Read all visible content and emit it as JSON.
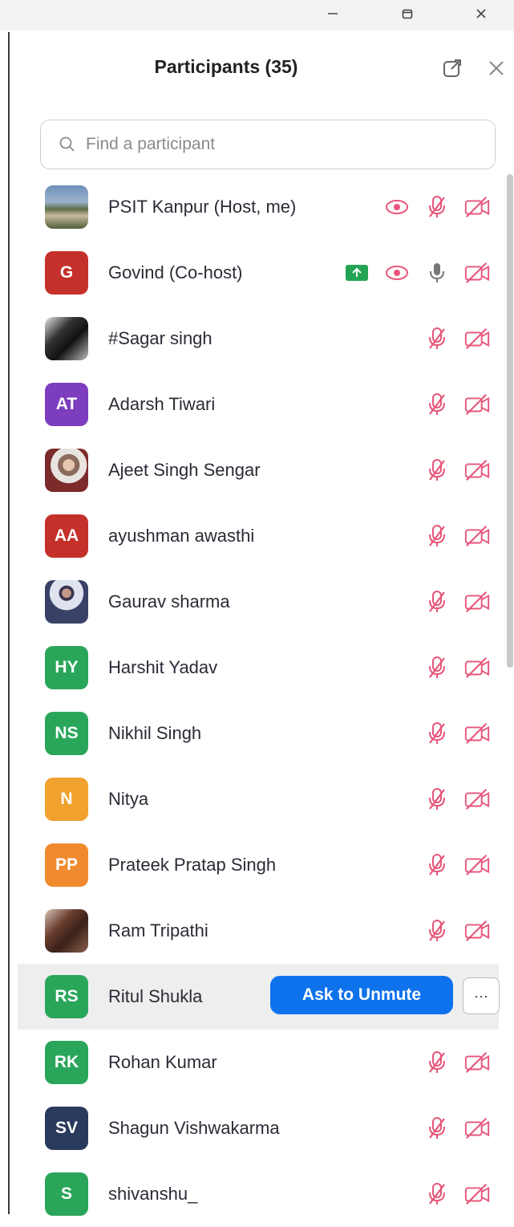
{
  "window": {
    "minimize_glyph": "–",
    "close_glyph": "✕"
  },
  "panel": {
    "title": "Participants (35)"
  },
  "search": {
    "placeholder": "Find a participant"
  },
  "colors": {
    "accent_blue": "#0e72ed",
    "muted_red": "#e8557a",
    "share_green": "#23a455"
  },
  "participants": [
    {
      "name": "PSIT Kanpur (Host, me)",
      "avatar": "photo-building",
      "icons": [
        "spotlight-icon",
        "mic-muted-icon",
        "video-off-icon"
      ]
    },
    {
      "name": "Govind (Co-host)",
      "initials": "G",
      "color": "#c4312a",
      "icons": [
        "screen-share-icon",
        "spotlight-icon",
        "mic-on-icon",
        "video-off-icon"
      ]
    },
    {
      "name": "#Sagar singh",
      "avatar": "photo-dark",
      "icons": [
        "mic-muted-icon",
        "video-off-icon"
      ]
    },
    {
      "name": "Adarsh Tiwari",
      "initials": "AT",
      "color": "#7d3dbf",
      "icons": [
        "mic-muted-icon",
        "video-off-icon"
      ]
    },
    {
      "name": "Ajeet Singh Sengar",
      "avatar": "photo-person",
      "icons": [
        "mic-muted-icon",
        "video-off-icon"
      ]
    },
    {
      "name": "ayushman awasthi",
      "initials": "AA",
      "color": "#c4312a",
      "icons": [
        "mic-muted-icon",
        "video-off-icon"
      ]
    },
    {
      "name": "Gaurav sharma",
      "avatar": "photo-person-2",
      "icons": [
        "mic-muted-icon",
        "video-off-icon"
      ]
    },
    {
      "name": "Harshit Yadav",
      "initials": "HY",
      "color": "#2aa65a",
      "icons": [
        "mic-muted-icon",
        "video-off-icon"
      ]
    },
    {
      "name": "Nikhil Singh",
      "initials": "NS",
      "color": "#2aa65a",
      "icons": [
        "mic-muted-icon",
        "video-off-icon"
      ]
    },
    {
      "name": "Nitya",
      "initials": "N",
      "color": "#f0a12e",
      "icons": [
        "mic-muted-icon",
        "video-off-icon"
      ]
    },
    {
      "name": "Prateek Pratap Singh",
      "initials": "PP",
      "color": "#f08a2e",
      "icons": [
        "mic-muted-icon",
        "video-off-icon"
      ]
    },
    {
      "name": "Ram Tripathi",
      "avatar": "photo-person-3",
      "icons": [
        "mic-muted-icon",
        "video-off-icon"
      ]
    },
    {
      "name": "Ritul Shukla",
      "initials": "RS",
      "color": "#2aa65a",
      "hovered": true,
      "action_label": "Ask to Unmute",
      "more_glyph": "···"
    },
    {
      "name": "Rohan Kumar",
      "initials": "RK",
      "color": "#2aa65a",
      "icons": [
        "mic-muted-icon",
        "video-off-icon"
      ]
    },
    {
      "name": "Shagun Vishwakarma",
      "initials": "SV",
      "color": "#2a3a5c",
      "icons": [
        "mic-muted-icon",
        "video-off-icon"
      ]
    },
    {
      "name": "shivanshu_",
      "initials": "S",
      "color": "#2aa65a",
      "icons": [
        "mic-muted-icon",
        "video-off-icon"
      ]
    }
  ]
}
